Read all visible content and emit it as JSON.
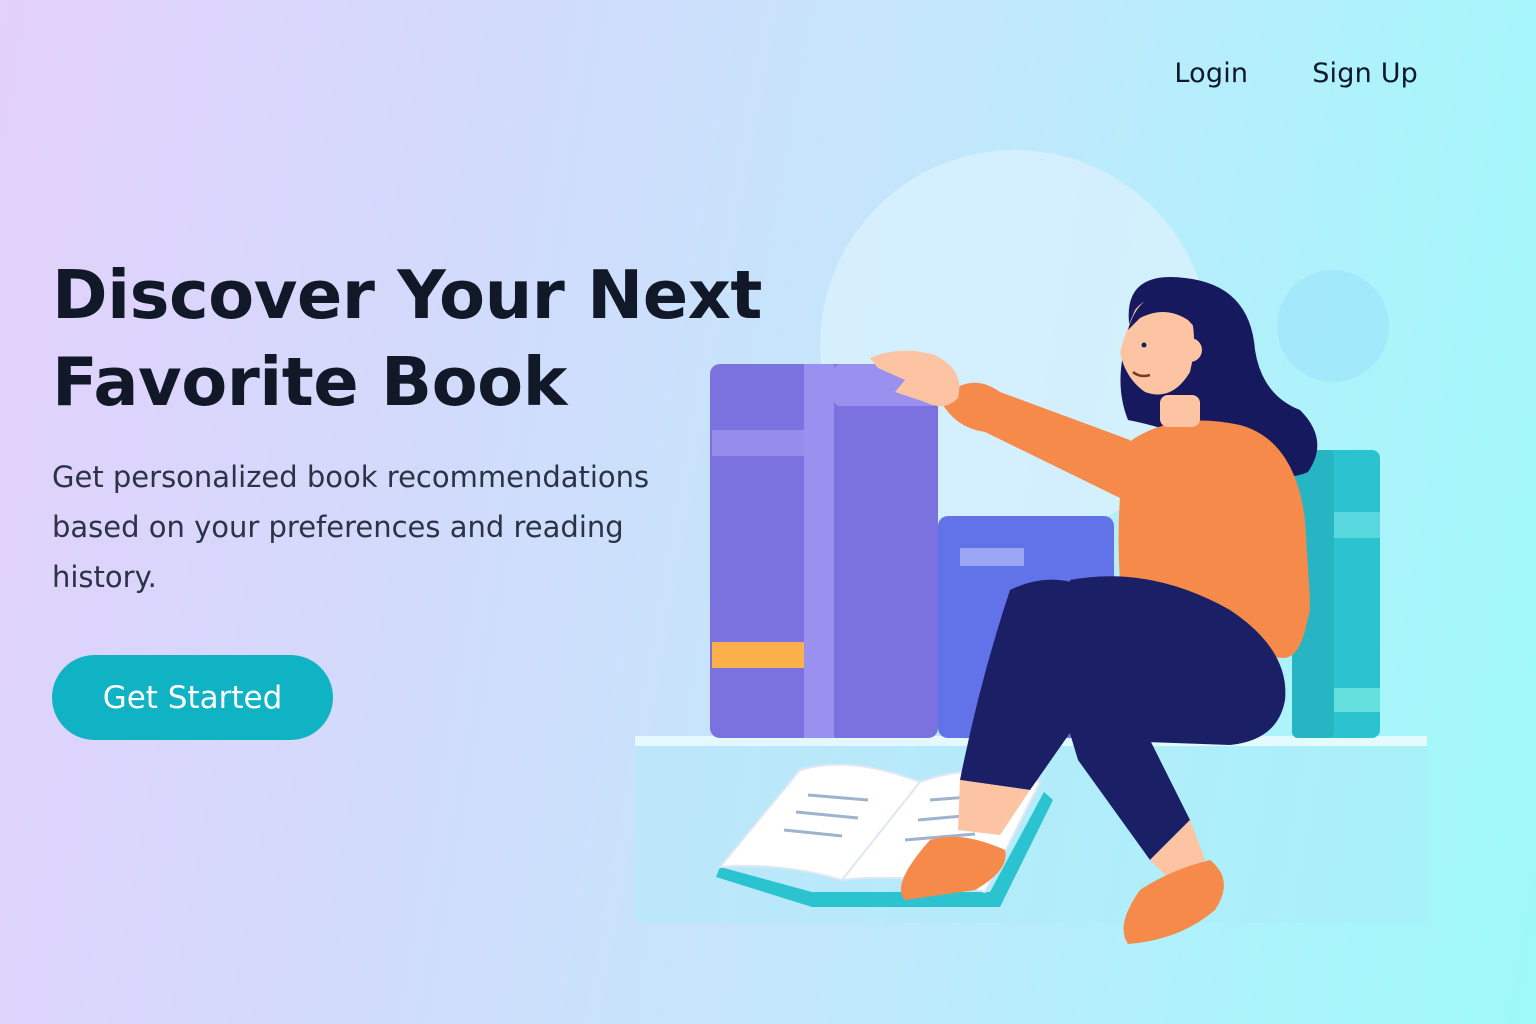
{
  "nav": {
    "login_label": "Login",
    "signup_label": "Sign Up"
  },
  "hero": {
    "title_line1": "Discover Your Next",
    "title_line2": "Favorite Book",
    "subtitle": "Get personalized book recommendations based on your preferences and reading history.",
    "cta_label": "Get Started"
  },
  "colors": {
    "accent": "#0fb3c4",
    "text_dark": "#111827",
    "sweater": "#f58a4b",
    "pants": "#1a1f66",
    "hair": "#16195e",
    "book_purple": "#7b72e0",
    "book_blue": "#6273ea",
    "book_teal": "#2cc3d1"
  },
  "illustration": {
    "subject": "woman-reading-books",
    "icons": [
      "book-stack-icon",
      "open-book-icon",
      "person-icon"
    ]
  }
}
